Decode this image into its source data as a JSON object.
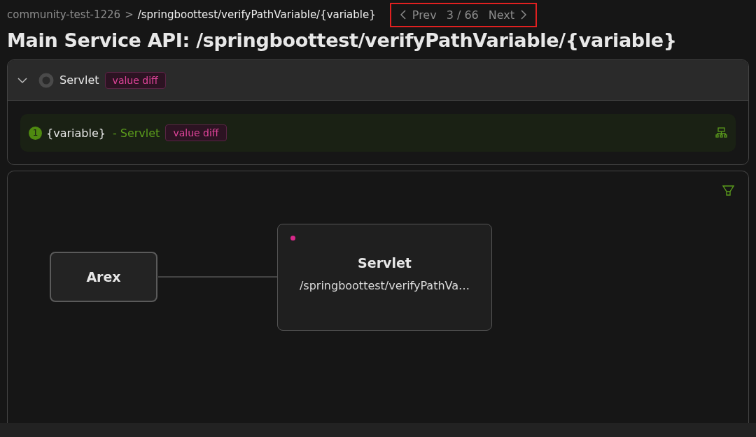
{
  "breadcrumb": {
    "app": "community-test-1226",
    "separator": ">",
    "path": "/springboottest/verifyPathVariable/{variable}"
  },
  "pager": {
    "prev": "Prev",
    "position": "3 / 66",
    "next": "Next",
    "highlighted": true
  },
  "title": "Main Service API: /springboottest/verifyPathVariable/{variable}",
  "diff_group": {
    "expanded": true,
    "name": "Servlet",
    "tag": "value diff",
    "items": [
      {
        "index": "1",
        "field": "{variable}",
        "source": "- Servlet",
        "tag": "value diff"
      }
    ]
  },
  "graph": {
    "nodes": [
      {
        "kind": "entry",
        "title": "Arex"
      },
      {
        "kind": "service",
        "title": "Servlet",
        "subtitle": "/springboottest/verifyPathVa…",
        "has_diff": true
      }
    ]
  }
}
